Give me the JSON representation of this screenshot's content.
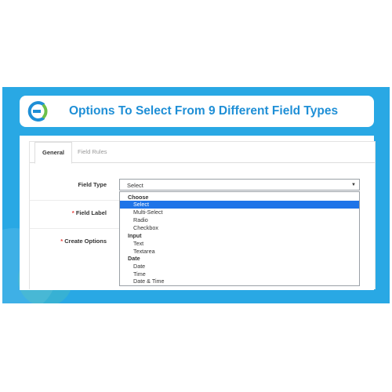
{
  "banner": {
    "title": "Options To Select From 9 Different Field Types",
    "logo_icon": "e-logo-icon",
    "background_color": "#29a8e4",
    "title_color": "#1f8fd6"
  },
  "tabs": [
    {
      "label": "General",
      "active": true
    },
    {
      "label": "Field Rules",
      "active": false
    }
  ],
  "form": {
    "field_type_label": "Field Type",
    "field_label_label": "Field Label",
    "create_options_label": "Create Options",
    "required_mark": "*",
    "select_value": "Select"
  },
  "dropdown": {
    "groups": [
      {
        "label": "Choose",
        "items": [
          "Select",
          "Multi-Select",
          "Radio",
          "Checkbox"
        ]
      },
      {
        "label": "Input",
        "items": [
          "Text",
          "Textarea"
        ]
      },
      {
        "label": "Date",
        "items": [
          "Date",
          "Time",
          "Date & Time"
        ]
      }
    ],
    "selected": "Select",
    "highlight_color": "#1e74e8"
  }
}
